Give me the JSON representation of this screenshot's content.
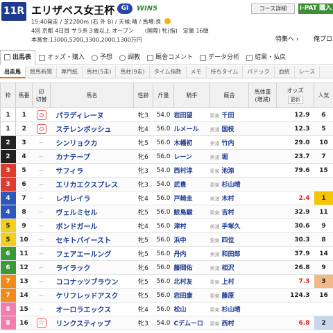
{
  "header": {
    "race_number": "11R",
    "race_name": "エリザベス女王杯",
    "grade": "GI",
    "win5": "WIN5",
    "info_line1": "15:40発走 / 芝2200m (右 外 B) / 天候:晴 / 馬場:良",
    "info_line2": "4回 京都 4日目 サラ系３歳以上 オープン　　(国際) 牝(指)　定量 16頭",
    "info_line3": "本賞金:13000,5200,3300,2000,1300万円",
    "course_detail": "コース詳細",
    "ipat": "i-PAT 購入",
    "feature_link": "特集へ ›",
    "my_link": "俺プロ"
  },
  "tabs_main": [
    {
      "label": "出馬表",
      "icon": "table-icon"
    },
    {
      "label": "オッズ・購入",
      "icon": "yen-icon"
    },
    {
      "label": "予想",
      "icon": "target-icon"
    },
    {
      "label": "調教",
      "icon": "clock-icon"
    },
    {
      "label": "厩舎コメント",
      "icon": "chat-icon"
    },
    {
      "label": "データ分析",
      "icon": "chart-icon"
    },
    {
      "label": "結果・払戻",
      "icon": "trophy-icon"
    }
  ],
  "tabs_sub": [
    "出走馬",
    "競馬新聞",
    "専門紙",
    "馬柱(5走)",
    "馬柱(9走)",
    "タイム指数",
    "メモ",
    "持ちタイム",
    "パドック",
    "血統",
    "レース"
  ],
  "columns": {
    "waku": "枠",
    "umaban": "馬番",
    "mark": "印",
    "mark_sub": "切替",
    "horse": "馬名",
    "sex_age": "性齢",
    "weight": "斤量",
    "jockey": "騎手",
    "trainer": "厩舎",
    "body_weight": "馬体重",
    "body_weight_sub": "(増減)",
    "odds": "オッズ",
    "odds_refresh": "更新",
    "popularity": "人気"
  },
  "waku_colors": {
    "1": "#ffffff",
    "2": "#222222",
    "3": "#e03b2f",
    "4": "#2e58b8",
    "5": "#f2d020",
    "6": "#3a9a3a",
    "7": "#f08a1a",
    "8": "#f07fb0"
  },
  "pop_colors": {
    "1": "#f5c500",
    "2": "#c8d6ea",
    "3": "#f2b886"
  },
  "rows": [
    {
      "waku": "1",
      "umaban": "1",
      "mark": "circle",
      "horse": "パラディレーヌ",
      "sex_age": "牝3",
      "weight": "54.0",
      "jockey": "岩田望",
      "area": "栗東",
      "trainer": "千田",
      "body_weight": "",
      "odds": "12.9",
      "popularity": "6",
      "hot": false
    },
    {
      "waku": "1",
      "umaban": "2",
      "mark": "circle",
      "horse": "ステレンボッシュ",
      "sex_age": "牝4",
      "weight": "56.0",
      "jockey": "ルメール",
      "area": "美浦",
      "trainer": "国枝",
      "body_weight": "",
      "odds": "12.3",
      "popularity": "5",
      "hot": false
    },
    {
      "waku": "2",
      "umaban": "3",
      "mark": "none",
      "horse": "シンリョクカ",
      "sex_age": "牝5",
      "weight": "56.0",
      "jockey": "木幡初",
      "area": "美浦",
      "trainer": "竹内",
      "body_weight": "",
      "odds": "29.0",
      "popularity": "10",
      "hot": false
    },
    {
      "waku": "2",
      "umaban": "4",
      "mark": "none",
      "horse": "カナテープ",
      "sex_age": "牝6",
      "weight": "56.0",
      "jockey": "レーン",
      "area": "美浦",
      "trainer": "堀",
      "body_weight": "",
      "odds": "23.7",
      "popularity": "7",
      "hot": false
    },
    {
      "waku": "3",
      "umaban": "5",
      "mark": "none",
      "horse": "サフィラ",
      "sex_age": "牝3",
      "weight": "54.0",
      "jockey": "西村淳",
      "area": "栗東",
      "trainer": "池添",
      "body_weight": "",
      "odds": "79.6",
      "popularity": "15",
      "hot": false
    },
    {
      "waku": "3",
      "umaban": "6",
      "mark": "none",
      "horse": "エリカエクスプレス",
      "sex_age": "牝3",
      "weight": "54.0",
      "jockey": "武豊",
      "area": "栗東",
      "trainer": "杉山晴",
      "body_weight": "",
      "odds": "",
      "popularity": "",
      "hot": false
    },
    {
      "waku": "4",
      "umaban": "7",
      "mark": "none",
      "horse": "レガレイラ",
      "sex_age": "牝4",
      "weight": "56.0",
      "jockey": "戸崎圭",
      "area": "美浦",
      "trainer": "木村",
      "body_weight": "",
      "odds": "2.4",
      "popularity": "1",
      "hot": true
    },
    {
      "waku": "4",
      "umaban": "8",
      "mark": "none",
      "horse": "ヴェルミセル",
      "sex_age": "牝5",
      "weight": "56.0",
      "jockey": "鮫島駿",
      "area": "栗東",
      "trainer": "吉村",
      "body_weight": "",
      "odds": "32.9",
      "popularity": "11",
      "hot": false
    },
    {
      "waku": "5",
      "umaban": "9",
      "mark": "none",
      "horse": "ボンドガール",
      "sex_age": "牝4",
      "weight": "56.0",
      "jockey": "津村",
      "area": "美浦",
      "trainer": "手塚久",
      "body_weight": "",
      "odds": "30.6",
      "popularity": "9",
      "hot": false
    },
    {
      "waku": "5",
      "umaban": "10",
      "mark": "none",
      "horse": "セキトバイースト",
      "sex_age": "牝5",
      "weight": "56.0",
      "jockey": "浜中",
      "area": "栗東",
      "trainer": "四位",
      "body_weight": "",
      "odds": "30.3",
      "popularity": "8",
      "hot": false
    },
    {
      "waku": "6",
      "umaban": "11",
      "mark": "none",
      "horse": "フェアエールング",
      "sex_age": "牝5",
      "weight": "56.0",
      "jockey": "丹内",
      "area": "美浦",
      "trainer": "和田郎",
      "body_weight": "",
      "odds": "37.9",
      "popularity": "14",
      "hot": false
    },
    {
      "waku": "6",
      "umaban": "12",
      "mark": "none",
      "horse": "ライラック",
      "sex_age": "牝6",
      "weight": "56.0",
      "jockey": "藤岡佑",
      "area": "美浦",
      "trainer": "相沢",
      "body_weight": "",
      "odds": "26.8",
      "popularity": "9",
      "hot": false
    },
    {
      "waku": "7",
      "umaban": "13",
      "mark": "none",
      "horse": "ココナッツブラウン",
      "sex_age": "牝5",
      "weight": "56.0",
      "jockey": "北村友",
      "area": "栗東",
      "trainer": "上村",
      "body_weight": "",
      "odds": "7.3",
      "popularity": "3",
      "hot": true
    },
    {
      "waku": "7",
      "umaban": "14",
      "mark": "none",
      "horse": "ケリフレッドアスク",
      "sex_age": "牝5",
      "weight": "56.0",
      "jockey": "岩田康",
      "area": "栗東",
      "trainer": "藤原",
      "body_weight": "",
      "odds": "124.3",
      "popularity": "16",
      "hot": false
    },
    {
      "waku": "8",
      "umaban": "15",
      "mark": "none",
      "horse": "オーロラエックス",
      "sex_age": "牝4",
      "weight": "56.0",
      "jockey": "松山",
      "area": "栗東",
      "trainer": "杉山晴",
      "body_weight": "",
      "odds": "",
      "popularity": "",
      "hot": false
    },
    {
      "waku": "8",
      "umaban": "16",
      "mark": "star",
      "horse": "リンクスティップ",
      "sex_age": "牝3",
      "weight": "54.0",
      "jockey": "Cデムーロ",
      "area": "栗東",
      "trainer": "西村",
      "body_weight": "",
      "odds": "6.8",
      "popularity": "2",
      "hot": true
    }
  ]
}
